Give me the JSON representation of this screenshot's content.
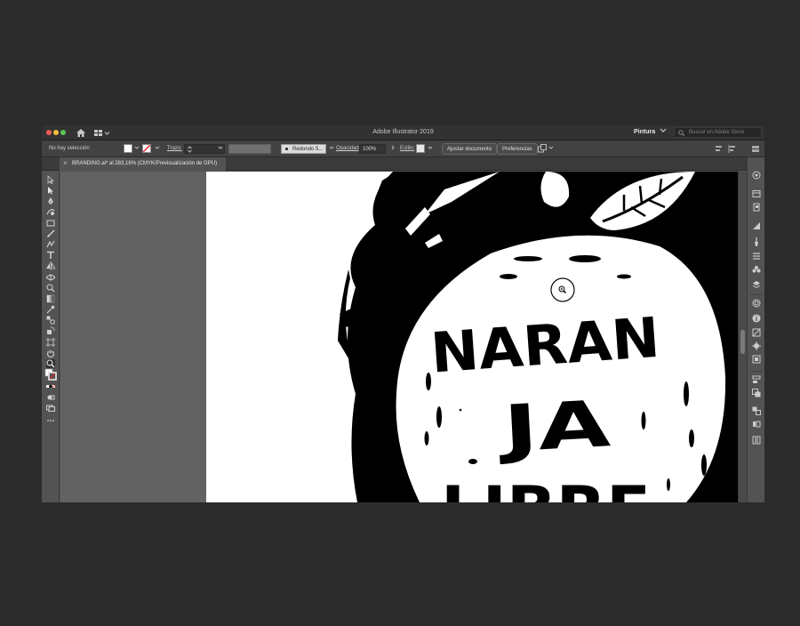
{
  "window": {
    "title": "Adobe Illustrator 2019",
    "workspace": "Pintura",
    "stock_search_placeholder": "Buscar en Adobe Stock"
  },
  "controlbar": {
    "selection_status": "No hay selección",
    "stroke_label": "Trazo:",
    "brush_label": "Redondo 5...",
    "opacity_label": "Opacidad",
    "opacity_value": "100%",
    "style_label": "Estilo:",
    "doc_setup_button": "Ajustar documento",
    "preferences_button": "Preferencias"
  },
  "document_tab": {
    "label": "BRANDING.ai* al 283,16% (CMYK/Previsualización de GPU)",
    "close_glyph": "×"
  },
  "tools": [
    "selection-tool",
    "direct-selection-tool",
    "pen-tool",
    "curvature-tool",
    "rectangle-tool",
    "paintbrush-tool",
    "shaper-tool",
    "type-tool",
    "reflect-tool",
    "width-tool",
    "shape-builder-tool",
    "gradient-tool",
    "eyedropper-tool",
    "blend-tool",
    "symbol-sprayer-tool",
    "artboard-tool",
    "hand-tool",
    "zoom-tool",
    "fill-stroke",
    "drawing-modes",
    "screen-mode",
    "edit-toolbar"
  ],
  "dock": [
    "color-guide-icon",
    "libraries-icon",
    "document-info-icon",
    "gradient-icon",
    "brushes-icon",
    "transparency-icon",
    "symbols-icon",
    "layers-icon",
    "appearance-icon",
    "info-icon",
    "graphic-styles-icon",
    "navigator-icon",
    "align-icon",
    "pathfinder-icon",
    "transform-icon",
    "artboards-icon"
  ],
  "artwork": {
    "lettering": "NARAN JA LIBRE"
  },
  "colors": {
    "ui_dark": "#323232",
    "ui_panel": "#535353",
    "pasteboard": "#626262",
    "artboard": "#ffffff",
    "ink": "#000000"
  }
}
